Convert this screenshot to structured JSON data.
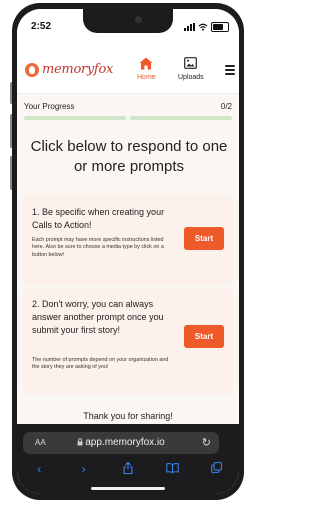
{
  "status_bar": {
    "time": "2:52"
  },
  "header": {
    "logo_text": "memoryfox",
    "nav": [
      {
        "label": "Home",
        "icon": "home-icon",
        "active": true
      },
      {
        "label": "Uploads",
        "icon": "image-icon",
        "active": false
      }
    ],
    "menu_icon": "hamburger-menu-icon"
  },
  "progress": {
    "label": "Your Progress",
    "count": "0/2",
    "completed": 0,
    "total": 2
  },
  "headline": "Click below to respond to one or more prompts",
  "prompts": [
    {
      "title": "1. Be specific when creating your Calls to Action!",
      "description": "Each prompt may have more specific instructions listed here. Also be sure to choose a media type by click on a button below!",
      "button_label": "Start"
    },
    {
      "title": "2. Don't worry, you can always answer another prompt once you submit your first story!",
      "description": "The number of prompts depend on your organization and the story they are asking of you!",
      "button_label": "Start"
    }
  ],
  "thanks_text": "Thank you for sharing!",
  "browser": {
    "aa_label": "AA",
    "url": "app.memoryfox.io",
    "toolbar_icons": [
      "back-icon",
      "forward-icon",
      "share-icon",
      "bookmarks-icon",
      "tabs-icon"
    ]
  },
  "colors": {
    "accent": "#ef5a2b",
    "brand": "#c2362b",
    "card_bg": "#fdf1ec",
    "progress": "#cfe6c9"
  }
}
